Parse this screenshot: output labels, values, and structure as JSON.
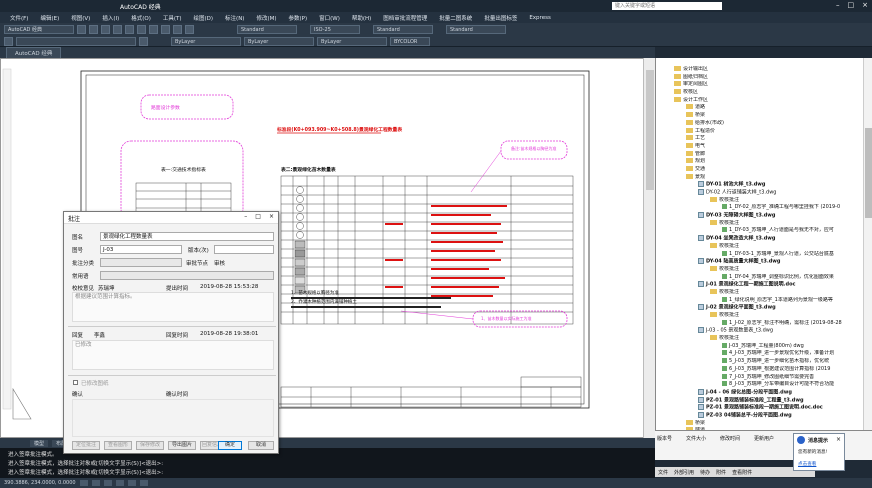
{
  "app": {
    "title": "AutoCAD 经典",
    "search_placeholder": "键入关键字或短语"
  },
  "menu": [
    "文件(F)",
    "编辑(E)",
    "视图(V)",
    "插入(I)",
    "格式(O)",
    "工具(T)",
    "绘图(D)",
    "标注(N)",
    "修改(M)",
    "参数(P)",
    "窗口(W)",
    "帮助(H)",
    "图档审批流程管理",
    "批量二图系统",
    "批量出图标签",
    "Express"
  ],
  "toolbar": {
    "workspace": "AutoCAD 经典",
    "text_style": "Standard",
    "dim_style": "ISO-25",
    "table_style": "Standard",
    "layer": "ByLayer",
    "linetype": "ByLayer",
    "lineweight": "ByLayer",
    "plotstyle": "BYCOLOR"
  },
  "doc_tab": "AutoCAD 经典",
  "layout_tabs": [
    "模型",
    "布局1"
  ],
  "drawing": {
    "title_red": "标准段(K0+093.909~K0+508.8)景观绿化工程数量表",
    "table_title": "表二:景观绿化苗木数量表",
    "small_table_title": "表一:交通技术指标表",
    "cloud_label1": "路面设计参数",
    "cloud_label2": "备注:苗木规格以胸径为准",
    "cloud_label3": "1、苗木数量以实际施工为准",
    "note1": "1、苗木规格以胸径为准",
    "note2": "2、乔灌木种植范围内满铺种植土"
  },
  "dialog": {
    "title": "批注",
    "label_drawing_name": "图名",
    "drawing_name_value": "景观绿化工程数量表",
    "label_drawing_no": "图号",
    "drawing_no_value": "J-03",
    "label_version": "版本(次)",
    "label_category": "批注分类",
    "label_approve_node": "审批节点",
    "approve_node_value": "审核",
    "label_common": "常用语",
    "label_checker": "校校意见",
    "checker_value": "苏瑞坤",
    "label_submit_time": "提出时间",
    "submit_time_value": "2019-08-28 15:53:28",
    "opinion_text": "根据建议范围计算指标。",
    "label_reply": "回复",
    "reply_person": "李鑫",
    "label_reply_time": "回复时间",
    "reply_time_value": "2019-08-28 19:38:01",
    "reply_text": "已修改",
    "label_confirm_chk": "已修改图纸",
    "label_confirm": "确认",
    "label_confirm_time": "确认时间",
    "btn_locate": "定位批注",
    "btn_view": "查看图形",
    "btn_save": "保存修改",
    "btn_export": "导出图片",
    "btn_feedback": "回复信息反馈",
    "btn_ok": "确定",
    "btn_cancel": "取消"
  },
  "tree": [
    {
      "indent": 6,
      "kind": "f",
      "text": "设计输出区"
    },
    {
      "indent": 6,
      "kind": "f",
      "text": "图纸归档区"
    },
    {
      "indent": 6,
      "kind": "f",
      "text": "审定阅图区"
    },
    {
      "indent": 6,
      "kind": "f",
      "text": "校核区"
    },
    {
      "indent": 6,
      "kind": "f",
      "text": "设计工作区"
    },
    {
      "indent": 10,
      "kind": "f",
      "text": "道路"
    },
    {
      "indent": 10,
      "kind": "f",
      "text": "桥梁"
    },
    {
      "indent": 10,
      "kind": "f",
      "text": "给排水(市政)"
    },
    {
      "indent": 10,
      "kind": "f",
      "text": "工程造价"
    },
    {
      "indent": 10,
      "kind": "f",
      "text": "工艺"
    },
    {
      "indent": 10,
      "kind": "f",
      "text": "电气"
    },
    {
      "indent": 10,
      "kind": "f",
      "text": "管廊"
    },
    {
      "indent": 10,
      "kind": "f",
      "text": "规划"
    },
    {
      "indent": 10,
      "kind": "f",
      "text": "交通"
    },
    {
      "indent": 10,
      "kind": "f",
      "text": "景观"
    },
    {
      "indent": 14,
      "kind": "d",
      "text": "DY-01 树池大样_t3.dwg",
      "bold": true
    },
    {
      "indent": 14,
      "kind": "d",
      "text": "DY-02 人行道铺装大样_t3.dwg"
    },
    {
      "indent": 18,
      "kind": "f",
      "text": "校核批注"
    },
    {
      "indent": 22,
      "kind": "c",
      "text": "1_DY-02_原志宇_准确工程与哪里挂我下 (2019-0"
    },
    {
      "indent": 14,
      "kind": "d",
      "text": "DY-03 无障碍大样图_t3.dwg",
      "bold": true
    },
    {
      "indent": 18,
      "kind": "f",
      "text": "校核批注"
    },
    {
      "indent": 22,
      "kind": "c",
      "text": "1_DY-03_苏瑞坤_人行道面是与我无不对，应可"
    },
    {
      "indent": 14,
      "kind": "d",
      "text": "DY-04 坐凳改造大样_t3.dwg",
      "bold": true
    },
    {
      "indent": 18,
      "kind": "f",
      "text": "校核批注"
    },
    {
      "indent": 22,
      "kind": "c",
      "text": "1_DY-03-1_苏瑞坤_景观人行道，公交站台底基"
    },
    {
      "indent": 14,
      "kind": "d",
      "text": "DY-04 陆高质量大样图_t3.dwg",
      "bold": true
    },
    {
      "indent": 18,
      "kind": "f",
      "text": "校核批注"
    },
    {
      "indent": 22,
      "kind": "c",
      "text": "1_DY-04_苏瑞坤_调整标识比例，优化图面效果"
    },
    {
      "indent": 14,
      "kind": "d",
      "text": "J-01 景观绿化工程一期施工图说明.doc",
      "bold": true
    },
    {
      "indent": 18,
      "kind": "f",
      "text": "校核批注"
    },
    {
      "indent": 22,
      "kind": "c",
      "text": "1_绿化说明_原志宇_1本道路列为景观一级路等"
    },
    {
      "indent": 14,
      "kind": "d",
      "text": "J-02 景观绿化平面图_t3.dwg",
      "bold": true
    },
    {
      "indent": 18,
      "kind": "f",
      "text": "校核批注"
    },
    {
      "indent": 22,
      "kind": "c",
      "text": "1_J-02_原志宇_标注不明确，需标注 (2019-08-28"
    },
    {
      "indent": 14,
      "kind": "d",
      "text": "J-03 - 05 景观数量表_t3.dwg"
    },
    {
      "indent": 18,
      "kind": "f",
      "text": "校核批注"
    },
    {
      "indent": 22,
      "kind": "c",
      "text": "J-03_苏瑞坤_工程量(800m) dwg"
    },
    {
      "indent": 22,
      "kind": "c",
      "text": "4_J-03_苏瑞坤_进一步景观优化升级，准备计划"
    },
    {
      "indent": 22,
      "kind": "c",
      "text": "5_J-03_苏瑞坤_进一步细化苗木指标，优化统"
    },
    {
      "indent": 22,
      "kind": "c",
      "text": "6_J-03_苏瑞坤_根据建议范围计算指标 (2019"
    },
    {
      "indent": 22,
      "kind": "c",
      "text": "7_J-03_苏瑞坤_修改图纸细节需要完善"
    },
    {
      "indent": 22,
      "kind": "c",
      "text": "8_J-03_苏瑞坤_分车带编目设计可能不符合功能"
    },
    {
      "indent": 14,
      "kind": "d",
      "text": "J-04 - 06 绿化总图-分段平面图.dwg",
      "bold": true
    },
    {
      "indent": 14,
      "kind": "d",
      "text": "PZ-01 景观路铺装标准段_工程量_t3.dwg",
      "bold": true
    },
    {
      "indent": 14,
      "kind": "d",
      "text": "PZ-01 景观路铺装标准段一期施工图说明.doc.doc",
      "bold": true
    },
    {
      "indent": 14,
      "kind": "d",
      "text": "PZ-03 04铺装总平-分段平面图.dwg",
      "bold": true
    },
    {
      "indent": 10,
      "kind": "f",
      "text": "桥梁"
    },
    {
      "indent": 10,
      "kind": "f",
      "text": "隧道"
    }
  ],
  "rhead": {
    "cols": [
      "版本号",
      "文件大小",
      "修改时间",
      "更新用户"
    ]
  },
  "rtabs": [
    "文件",
    "外部引用",
    "待办",
    "附件",
    "查看附件"
  ],
  "toast": {
    "title": "消息提示",
    "body": "您有新的消息!",
    "link": "点击查看"
  },
  "cmdline": [
    "进入签章批注模式。",
    "进入签章批注模式，选择批注对象或[切换文字显示(S)]<退出>:",
    "进入签章批注模式，选择批注对象或[切换文字显示(S)]<退出>:"
  ],
  "status_coords": "390.3886, 234.0000, 0.0000"
}
